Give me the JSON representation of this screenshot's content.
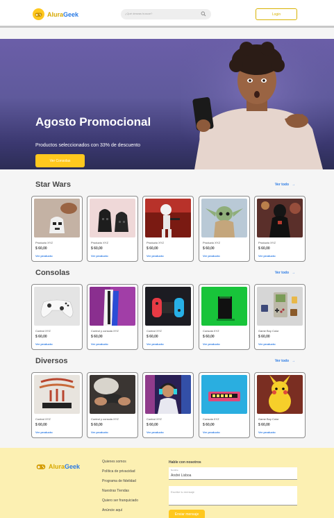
{
  "header": {
    "logo_text_a": "Alura",
    "logo_text_b": "Geek",
    "search_placeholder": "¿Qué deseas buscar?",
    "login_label": "Login"
  },
  "banner": {
    "title": "Agosto Promocional",
    "subtitle": "Productos seleccionados con 33% de descuento",
    "button_label": "Ver Consolas"
  },
  "sections": [
    {
      "title": "Star Wars",
      "see_all": "Ver todo",
      "products": [
        {
          "name": "Producto XYZ",
          "price": "$ 60,00",
          "link": "Ver producto",
          "icon": "stormtrooper-helmet-icon"
        },
        {
          "name": "Producto XYZ",
          "price": "$ 60,00",
          "link": "Ver producto",
          "icon": "darth-vader-helmet-icon"
        },
        {
          "name": "Producto XYZ",
          "price": "$ 60,00",
          "link": "Ver producto",
          "icon": "stormtrooper-figure-icon"
        },
        {
          "name": "Producto XYZ",
          "price": "$ 60,00",
          "link": "Ver producto",
          "icon": "baby-yoda-icon"
        },
        {
          "name": "Producto XYZ",
          "price": "$ 60,00",
          "link": "Ver producto",
          "icon": "darth-vader-figure-icon"
        }
      ]
    },
    {
      "title": "Consolas",
      "see_all": "Ver todo",
      "products": [
        {
          "name": "Control XYZ",
          "price": "$ 60,00",
          "link": "Ver producto",
          "icon": "xbox-controller-icon"
        },
        {
          "name": "Control y consola XYZ",
          "price": "$ 60,00",
          "link": "Ver producto",
          "icon": "ps5-console-icon"
        },
        {
          "name": "Control XYZ",
          "price": "$ 60,00",
          "link": "Ver producto",
          "icon": "switch-joycon-icon"
        },
        {
          "name": "Consola XYZ",
          "price": "$ 60,00",
          "link": "Ver producto",
          "icon": "xbox-series-x-icon"
        },
        {
          "name": "Game Boy Color",
          "price": "$ 60,00",
          "link": "Ver producto",
          "icon": "game-boy-icon"
        }
      ]
    },
    {
      "title": "Diversos",
      "see_all": "Ver todo",
      "products": [
        {
          "name": "Control XYZ",
          "price": "$ 60,00",
          "link": "Ver producto",
          "icon": "atari-shirt-icon"
        },
        {
          "name": "Control y consola XYZ",
          "price": "$ 60,00",
          "link": "Ver producto",
          "icon": "hands-controller-icon"
        },
        {
          "name": "Control XYZ",
          "price": "$ 60,00",
          "link": "Ver producto",
          "icon": "gamer-headset-icon"
        },
        {
          "name": "Consola XYZ",
          "price": "$ 60,00",
          "link": "Ver producto",
          "icon": "retro-console-icon"
        },
        {
          "name": "Game Boy Color",
          "price": "$ 60,00",
          "link": "Ver producto",
          "icon": "pikachu-plush-icon"
        }
      ]
    }
  ],
  "footer": {
    "logo_text_a": "Alura",
    "logo_text_b": "Geek",
    "links": [
      "Quienes somos",
      "Política de privacidad",
      "Programa de fidelidad",
      "Nuestras Tiendas",
      "Quiero ser franquiciado",
      "Anúncie aquí"
    ],
    "form_title": "Hable con nosotros",
    "name_label": "Nombre",
    "name_value": "André Lisboa",
    "message_placeholder": "Escribe tu mensaje",
    "send_label": "Enviar mensaje"
  },
  "colors": {
    "accent": "#ffc81e",
    "link": "#2a7ae4",
    "footer_bg": "#fcf0b2"
  }
}
